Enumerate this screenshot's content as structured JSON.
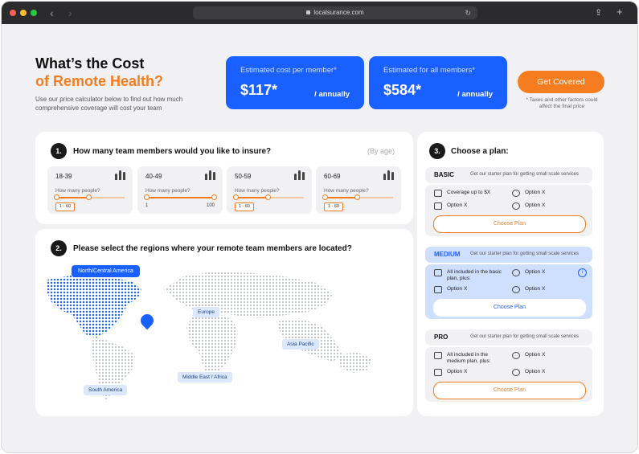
{
  "browser": {
    "url": "localsurance.com",
    "back": "‹",
    "forward": "›",
    "reload": "↻",
    "share": "⇪",
    "new_tab": "+"
  },
  "colors": {
    "accent": "#f57c1f",
    "brand_blue": "#1a5fff",
    "titlebar": "#2b2b2e"
  },
  "hero": {
    "title_line1": "What’s the Cost",
    "title_line2": "of Remote Health?",
    "subtitle": "Use our price calculator below to find out how much comprehensive coverage will cost your team"
  },
  "cost_cards": [
    {
      "label": "Estimated cost per member*",
      "amount": "$117*",
      "period": "/ annually"
    },
    {
      "label": "Estimated for all members*",
      "amount": "$584*",
      "period": "/ annually"
    }
  ],
  "cta": {
    "label": "Get Covered",
    "note": "* Taxes and other factors could affect the final price"
  },
  "step1": {
    "number": "1.",
    "title": "How many team members would you like to insure?",
    "hint": "(By age)",
    "groups": [
      {
        "range": "18-39",
        "question": "How many people?",
        "chip": "1 - 60"
      },
      {
        "range": "40-49",
        "question": "How many people?",
        "min": "1",
        "max": "100"
      },
      {
        "range": "50-59",
        "question": "How many people?",
        "chip": "1 - 60"
      },
      {
        "range": "60-69",
        "question": "How many people?",
        "chip": "1 - 60"
      }
    ]
  },
  "step2": {
    "number": "2.",
    "title": "Please select the regions where your remote team members are located?",
    "regions": [
      "North/Central America",
      "Europe",
      "Asia Pacific",
      "Middle East / Africa",
      "South America"
    ],
    "selected": "North/Central America"
  },
  "step3": {
    "number": "3.",
    "title": "Choose a plan:",
    "plans": [
      {
        "name": "BASIC",
        "desc": "Get our starter plan for getting small scale services",
        "f1": "Coverage up to $X",
        "f2": "Option X",
        "f3": "Option X",
        "f4": "Option X",
        "button": "Choose Plan"
      },
      {
        "name": "MEDIUM",
        "desc": "Get our starter plan for getting small scale services",
        "f1": "All included in the basic plan, plus:",
        "f2": "Option X",
        "f3": "Option X",
        "f4": "Option X",
        "button": "Choose Plan",
        "info": "i"
      },
      {
        "name": "PRO",
        "desc": "Get our starter plan for getting small scale services",
        "f1": "All included in the medium plan, plus:",
        "f2": "Option X",
        "f3": "Option X",
        "f4": "Option X",
        "button": "Choose Plan"
      }
    ]
  }
}
